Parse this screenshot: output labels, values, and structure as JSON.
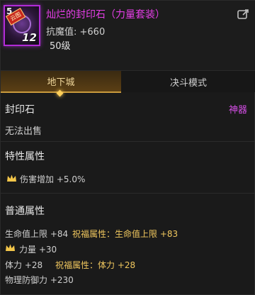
{
  "item": {
    "icon_level": "5",
    "icon_badge": "云图",
    "icon_number": "12",
    "name": "灿烂的封印石（力量套装）",
    "attack_label": "抗魔值: +660",
    "level": "50级"
  },
  "tabs": {
    "active": "地下城",
    "inactive": "决斗模式"
  },
  "body": {
    "category_left": "封印石",
    "category_right": "神器",
    "trade": "无法出售",
    "special_title": "特性属性",
    "special_attr": "伤害增加 +5.0%",
    "normal_title": "普通属性",
    "normal_lines": [
      {
        "a": "生命值上限 +84",
        "b": "祝福属性：生命值上限 +83"
      },
      {
        "a": "力量 +30"
      },
      {
        "a": "体力 +28",
        "b": "祝福属性：体力 +28"
      },
      {
        "a": "物理防御力 +230"
      }
    ]
  },
  "colors": {
    "name": "#e63ee8",
    "rarity": "#d54ee6",
    "blessing": "#f0c75e",
    "accent": "#ffcf5a"
  },
  "icons": [
    "share-icon",
    "crown-icon"
  ]
}
